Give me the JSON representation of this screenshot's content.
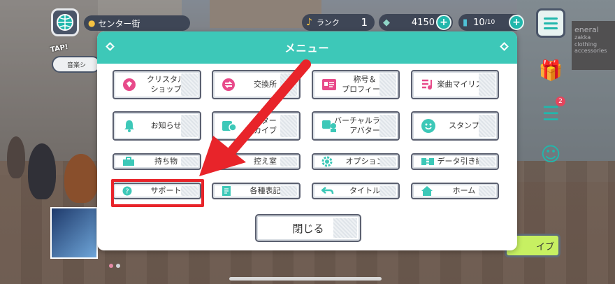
{
  "hud": {
    "location": "センター街",
    "rank_label": "ランク",
    "rank_value": "1",
    "gems": "4150",
    "tickets": "10",
    "tickets_max": "/10",
    "tap_label": "TAP!",
    "music_short": "音楽シ"
  },
  "shop_sign": {
    "line1": "eneral",
    "line2": "zakka",
    "line3": "clothing",
    "line4": "accessories"
  },
  "notification_count": "2",
  "right_cta_label": "イブ",
  "menu": {
    "title": "メニュー",
    "items": [
      {
        "label": "クリスタル\nショップ",
        "icon": "crystal-icon"
      },
      {
        "label": "交換所",
        "icon": "exchange-icon"
      },
      {
        "label": "称号＆\nプロフィール",
        "icon": "profile-card-icon"
      },
      {
        "label": "楽曲マイリスト",
        "icon": "music-list-icon"
      },
      {
        "label": "お知らせ",
        "icon": "bell-icon"
      },
      {
        "label": "クター\nカイブ",
        "icon": "character-archive-icon"
      },
      {
        "label": "バーチャルライブ\nアバター",
        "icon": "avatar-icon"
      },
      {
        "label": "スタンプ",
        "icon": "stamp-icon"
      },
      {
        "label": "持ち物",
        "icon": "bag-icon"
      },
      {
        "label": "控え室",
        "icon": "room-icon"
      },
      {
        "label": "オプション",
        "icon": "gear-icon"
      },
      {
        "label": "データ引き継ぎ",
        "icon": "transfer-icon"
      },
      {
        "label": "サポート",
        "icon": "help-icon"
      },
      {
        "label": "各種表記",
        "icon": "document-icon"
      },
      {
        "label": "タイトル",
        "icon": "back-arrow-icon"
      },
      {
        "label": "ホーム",
        "icon": "home-icon"
      }
    ],
    "close_label": "閉じる"
  },
  "colors": {
    "accent": "#3dc8b8",
    "highlight": "#e8242a"
  }
}
